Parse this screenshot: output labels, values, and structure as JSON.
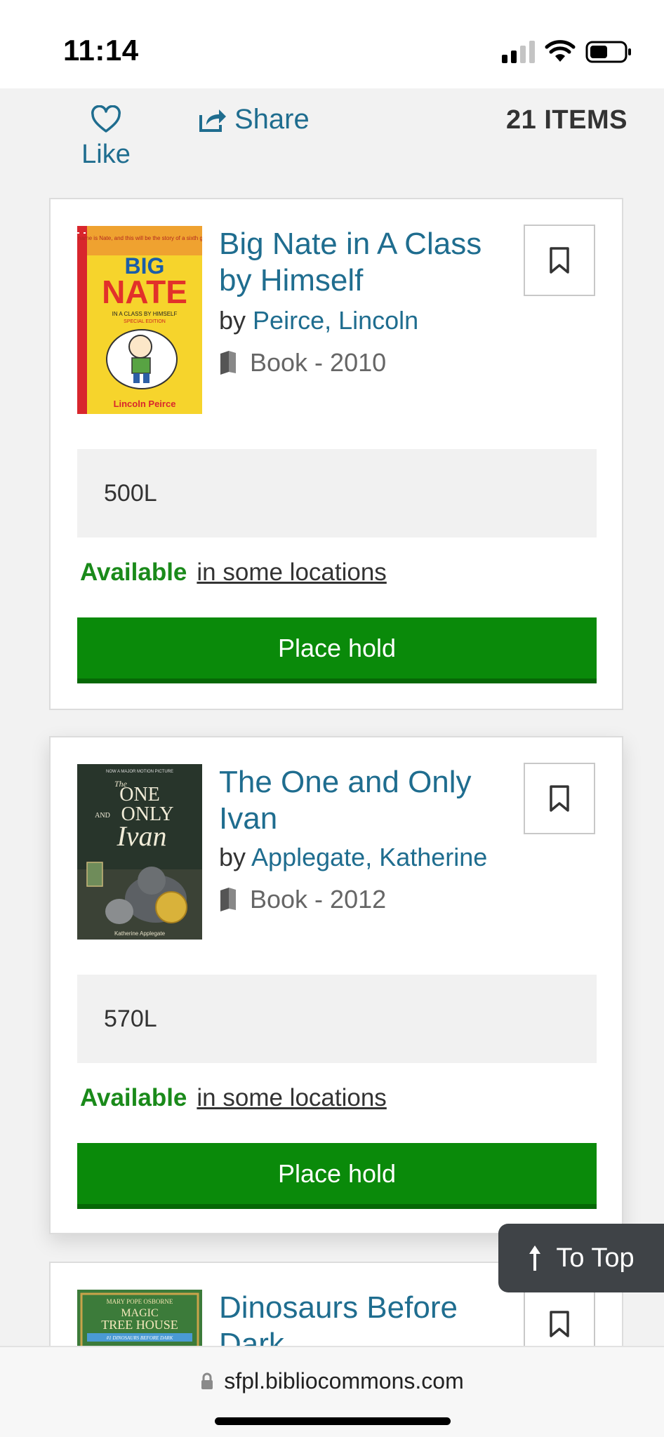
{
  "status_bar": {
    "time": "11:14"
  },
  "actions": {
    "like_label": "Like",
    "share_label": "Share",
    "items_count": "21 ITEMS"
  },
  "items": [
    {
      "title": "Big Nate in A Class by Himself",
      "by": "by",
      "author": "Peirce, Lincoln",
      "format": "Book - 2010",
      "lexile": "500L",
      "availability": "Available",
      "location_link": "in some locations",
      "hold_label": "Place hold",
      "cover": {
        "line1": "BIG",
        "line2": "NATE",
        "subtitle": "IN A CLASS BY HIMSELF",
        "edition": "SPECIAL EDITION",
        "author": "Lincoln Peirce",
        "blurb": "\"My name is Nate, and this will be the story of a sixth grader...\""
      }
    },
    {
      "title": "The One and Only Ivan",
      "by": "by",
      "author": "Applegate, Katherine",
      "format": "Book - 2012",
      "lexile": "570L",
      "availability": "Available",
      "location_link": "in some locations",
      "hold_label": "Place hold",
      "cover": {
        "the": "The",
        "one": "ONE",
        "and": "AND",
        "only": "ONLY",
        "ivan": "Ivan",
        "author": "Katherine Applegate",
        "top": "NOW A MAJOR MOTION PICTURE"
      }
    },
    {
      "title": "Dinosaurs Before Dark",
      "cover": {
        "author": "MARY POPE OSBORNE",
        "line1": "MAGIC",
        "line2": "TREE HOUSE",
        "banner": "#1 DINOSAURS BEFORE DARK"
      }
    }
  ],
  "to_top_label": "To Top",
  "browser": {
    "url": "sfpl.bibliocommons.com"
  },
  "colors": {
    "link": "#1f6d8f",
    "available": "#1a8a1a",
    "hold_button": "#0a8a0a"
  }
}
